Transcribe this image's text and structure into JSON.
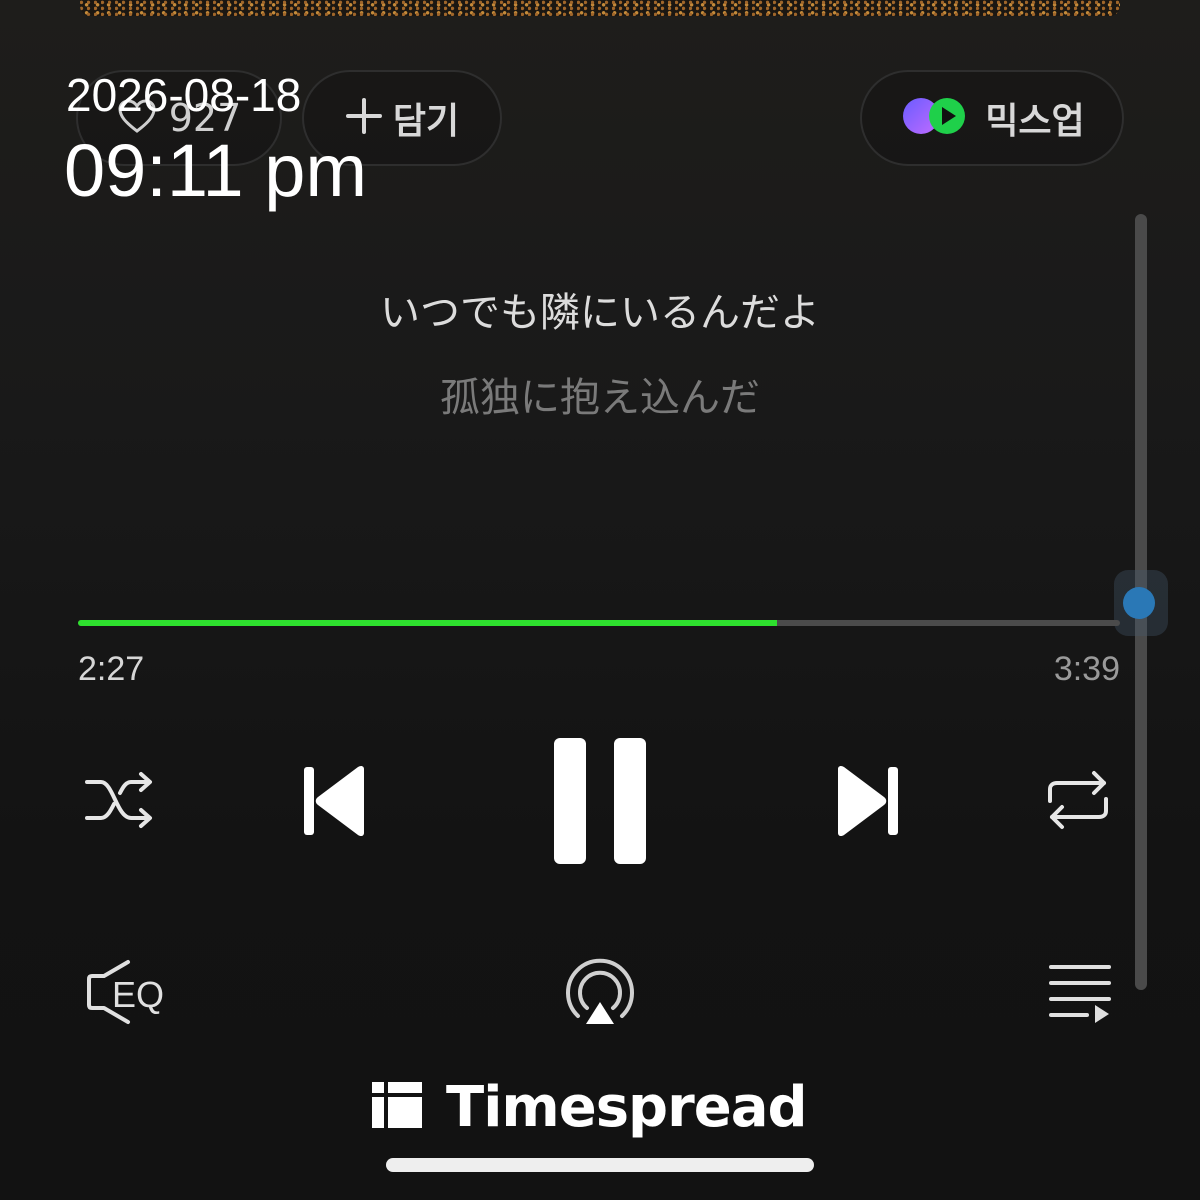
{
  "overlay": {
    "date": "2026-08-18",
    "time": "09:11 pm"
  },
  "top_actions": {
    "like_count": "927",
    "add_label": "담기",
    "mixup_label": "믹스업"
  },
  "lyrics": {
    "current": "いつでも隣にいるんだよ",
    "next": "孤独に抱え込んだ"
  },
  "player": {
    "elapsed": "2:27",
    "total": "3:39",
    "progress_fraction": 0.6712,
    "accent_color": "#2ee02e"
  },
  "controls": {
    "shuffle_icon": "shuffle-icon",
    "previous_icon": "previous-icon",
    "pause_icon": "pause-icon",
    "next_icon": "next-icon",
    "repeat_icon": "repeat-icon"
  },
  "bottom_actions": {
    "eq_label": "EQ",
    "airplay_icon": "airplay-icon",
    "playlist_icon": "playlist-icon"
  },
  "watermark": {
    "brand_name": "Timespread"
  }
}
